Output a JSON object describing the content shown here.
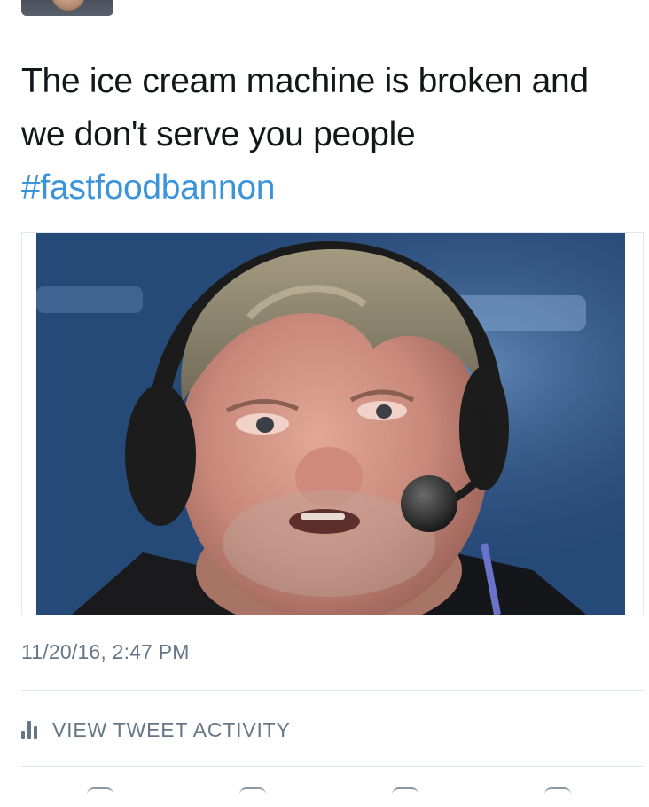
{
  "tweet": {
    "text_lines": [
      "The ice cream machine is broken and",
      "we don't serve you people"
    ],
    "hashtag": "#fastfoodbannon",
    "timestamp": "11/20/16, 2:47 PM"
  },
  "activity": {
    "label": "VIEW TWEET ACTIVITY"
  },
  "colors": {
    "link": "#3b94d9",
    "muted": "#657786",
    "divider": "#e1e8ed",
    "text": "#14171a"
  },
  "icons": {
    "activity": "bar-chart-icon",
    "actions": [
      "reply-icon",
      "retweet-icon",
      "like-icon",
      "share-icon"
    ]
  }
}
